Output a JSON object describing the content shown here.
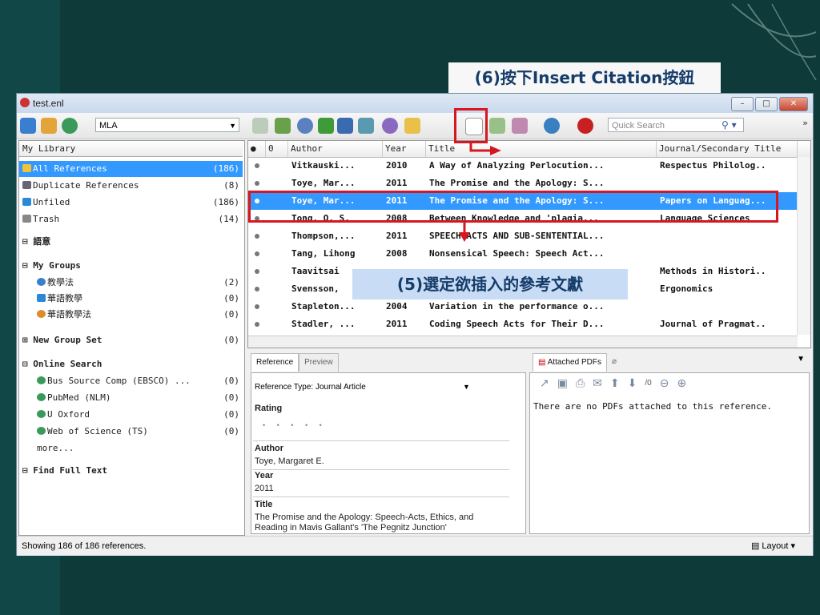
{
  "window": {
    "title": "test.enl"
  },
  "toolbar": {
    "style": "MLA",
    "quick_search_placeholder": "Quick Search",
    "more": "»"
  },
  "library": {
    "header": "My Library",
    "items": [
      {
        "label": "All References",
        "count": "(186)",
        "icon": "all-references-icon"
      },
      {
        "label": "Duplicate References",
        "count": "(8)",
        "icon": "duplicate-icon"
      },
      {
        "label": "Unfiled",
        "count": "(186)",
        "icon": "unfiled-icon"
      },
      {
        "label": "Trash",
        "count": "(14)",
        "icon": "trash-icon"
      }
    ],
    "group_yuyi": "語意",
    "my_groups": "My Groups",
    "groups": [
      {
        "label": "教學法",
        "count": "(2)"
      },
      {
        "label": "華語教學",
        "count": "(0)"
      },
      {
        "label": "華語教學法",
        "count": "(0)"
      }
    ],
    "new_group_set": "New Group Set",
    "new_group_set_count": "(0)",
    "online_search": "Online Search",
    "online": [
      {
        "label": "Bus Source Comp (EBSCO) ...",
        "count": "(0)"
      },
      {
        "label": "PubMed (NLM)",
        "count": "(0)"
      },
      {
        "label": "U Oxford",
        "count": "(0)"
      },
      {
        "label": "Web of Science (TS)",
        "count": "(0)"
      }
    ],
    "more": "more...",
    "find_full_text": "Find Full Text"
  },
  "refs": {
    "columns": {
      "attach": "0",
      "author": "Author",
      "year": "Year",
      "title": "Title",
      "journal": "Journal/Secondary Title"
    },
    "rows": [
      {
        "author": "Vitkauski...",
        "year": "2010",
        "title": "A Way of Analyzing Perlocution...",
        "journal": "Respectus Philolog.."
      },
      {
        "author": "Toye, Mar...",
        "year": "2011",
        "title": "The Promise and the Apology: S...",
        "journal": ""
      },
      {
        "author": "Toye, Mar...",
        "year": "2011",
        "title": "The Promise and the Apology: S...",
        "journal": "Papers on Languag..."
      },
      {
        "author": "Tong, Q. S.",
        "year": "2008",
        "title": "Between Knowledge and 'plagia...",
        "journal": "Language Sciences"
      },
      {
        "author": "Thompson,...",
        "year": "2011",
        "title": "SPEECH ACTS AND SUB-SENTENTIAL...",
        "journal": ""
      },
      {
        "author": "Tang, Lihong",
        "year": "2008",
        "title": "Nonsensical Speech: Speech Act...",
        "journal": ""
      },
      {
        "author": "Taavitsai",
        "year": "",
        "title": "..",
        "journal": "Methods in Histori.."
      },
      {
        "author": "Svensson,",
        "year": "",
        "title": "..",
        "journal": "Ergonomics"
      },
      {
        "author": "Stapleton...",
        "year": "2004",
        "title": "Variation in the performance o...",
        "journal": ""
      },
      {
        "author": "Stadler, ...",
        "year": "2011",
        "title": "Coding Speech Acts for Their D...",
        "journal": "Journal of Pragmat.."
      }
    ]
  },
  "reference_panel": {
    "tab_reference": "Reference",
    "tab_preview": "Preview",
    "ref_type_label": "Reference Type:",
    "ref_type_value": "Journal Article",
    "rating_label": "Rating",
    "author_label": "Author",
    "author_value": "Toye, Margaret E.",
    "year_label": "Year",
    "year_value": "2011",
    "title_label": "Title",
    "title_value": "The Promise and the Apology: Speech-Acts, Ethics, and Reading in Mavis Gallant's 'The Pegnitz Junction'"
  },
  "pdf_panel": {
    "tab_label": "Attached PDFs",
    "page_count": "/0",
    "message": "There are no PDFs attached to this reference."
  },
  "status": {
    "text": "Showing 186 of 186 references.",
    "layout": "Layout"
  },
  "annotations": {
    "step6": "(6)按下Insert Citation按鈕",
    "step5": "(5)選定欲插入的參考文獻"
  },
  "colors": {
    "accent": "#3399ff",
    "highlight": "#d7171f",
    "bg": "#0e3a3a"
  }
}
